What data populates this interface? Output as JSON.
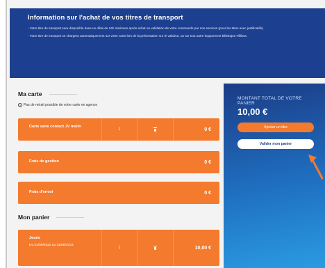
{
  "banner": {
    "title": "Information sur l'achat de vos titres de transport",
    "line1": "- Votre titre de transport sera disponible dans un délai de 24h minimum après achat ou validation de votre commande par nos services (pour les titres avec justificatifs).",
    "line2": "- Votre titre de transport se chargera automatiquement sur votre carte lors de la présentation sur le valideur, ou sur tout autre équipement billettique Fillibus."
  },
  "card_section": {
    "title": "Ma carte",
    "notice": "Pas de retrait possible de votre carte en agence",
    "items": [
      {
        "label": "Carte sans contact JV malin",
        "qty": "1",
        "price": "0 €"
      },
      {
        "label": "Frais de gestion",
        "price": "0 €"
      },
      {
        "label": "Frais d'envoi",
        "price": "0 €"
      }
    ]
  },
  "basket_section": {
    "title": "Mon panier",
    "items": [
      {
        "label": "Jeune",
        "period": "Du 01/09/2022 au 31/08/2023",
        "qty": "1",
        "price": "10,00 €"
      }
    ]
  },
  "summary": {
    "caption": "MONTANT TOTAL DE VOTRE PANIER",
    "total": "10,00 €",
    "add_label": "Ajouter un titre",
    "validate_label": "Valider mon panier"
  },
  "colors": {
    "banner": "#1d3f8f",
    "row": "#f47a2e",
    "accent": "#f47a2e"
  }
}
